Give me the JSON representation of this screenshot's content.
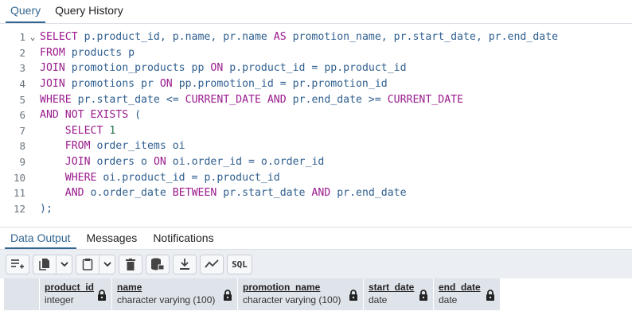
{
  "tabs": {
    "query": "Query",
    "history": "Query History"
  },
  "editor": {
    "lines": [
      {
        "n": "1",
        "fold": true,
        "tokens": [
          [
            "kw",
            "SELECT"
          ],
          [
            "pl",
            " p.product_id, p.name, pr.name "
          ],
          [
            "kw",
            "AS"
          ],
          [
            "pl",
            " promotion_name, pr.start_date, pr.end_date"
          ]
        ]
      },
      {
        "n": "2",
        "tokens": [
          [
            "kw",
            "FROM"
          ],
          [
            "pl",
            " products p"
          ]
        ]
      },
      {
        "n": "3",
        "tokens": [
          [
            "kw",
            "JOIN"
          ],
          [
            "pl",
            " promotion_products pp "
          ],
          [
            "kw",
            "ON"
          ],
          [
            "pl",
            " p.product_id = pp.product_id"
          ]
        ]
      },
      {
        "n": "4",
        "tokens": [
          [
            "kw",
            "JOIN"
          ],
          [
            "pl",
            " promotions pr "
          ],
          [
            "kw",
            "ON"
          ],
          [
            "pl",
            " pp.promotion_id = pr.promotion_id"
          ]
        ]
      },
      {
        "n": "5",
        "tokens": [
          [
            "kw",
            "WHERE"
          ],
          [
            "pl",
            " pr.start_date <= "
          ],
          [
            "kw",
            "CURRENT_DATE"
          ],
          [
            "pl",
            " "
          ],
          [
            "kw",
            "AND"
          ],
          [
            "pl",
            " pr.end_date >= "
          ],
          [
            "kw",
            "CURRENT_DATE"
          ]
        ]
      },
      {
        "n": "6",
        "tokens": [
          [
            "kw",
            "AND NOT EXISTS"
          ],
          [
            "pl",
            " ("
          ]
        ]
      },
      {
        "n": "7",
        "tokens": [
          [
            "pl",
            "    "
          ],
          [
            "kw",
            "SELECT"
          ],
          [
            "pl",
            " "
          ],
          [
            "num",
            "1"
          ]
        ]
      },
      {
        "n": "8",
        "tokens": [
          [
            "pl",
            "    "
          ],
          [
            "kw",
            "FROM"
          ],
          [
            "pl",
            " order_items oi"
          ]
        ]
      },
      {
        "n": "9",
        "tokens": [
          [
            "pl",
            "    "
          ],
          [
            "kw",
            "JOIN"
          ],
          [
            "pl",
            " orders o "
          ],
          [
            "kw",
            "ON"
          ],
          [
            "pl",
            " oi.order_id = o.order_id"
          ]
        ]
      },
      {
        "n": "10",
        "tokens": [
          [
            "pl",
            "    "
          ],
          [
            "kw",
            "WHERE"
          ],
          [
            "pl",
            " oi.product_id = p.product_id"
          ]
        ]
      },
      {
        "n": "11",
        "tokens": [
          [
            "pl",
            "    "
          ],
          [
            "kw",
            "AND"
          ],
          [
            "pl",
            " o.order_date "
          ],
          [
            "kw",
            "BETWEEN"
          ],
          [
            "pl",
            " pr.start_date "
          ],
          [
            "kw",
            "AND"
          ],
          [
            "pl",
            " pr.end_date"
          ]
        ]
      },
      {
        "n": "12",
        "tokens": [
          [
            "pl",
            ");"
          ]
        ]
      }
    ]
  },
  "output_tabs": {
    "data_output": "Data Output",
    "messages": "Messages",
    "notifications": "Notifications"
  },
  "toolbar": {
    "sql_label": "SQL"
  },
  "columns": [
    {
      "name": "product_id",
      "type": "integer"
    },
    {
      "name": "name",
      "type": "character varying (100)"
    },
    {
      "name": "promotion_name",
      "type": "character varying (100)"
    },
    {
      "name": "start_date",
      "type": "date"
    },
    {
      "name": "end_date",
      "type": "date"
    }
  ]
}
